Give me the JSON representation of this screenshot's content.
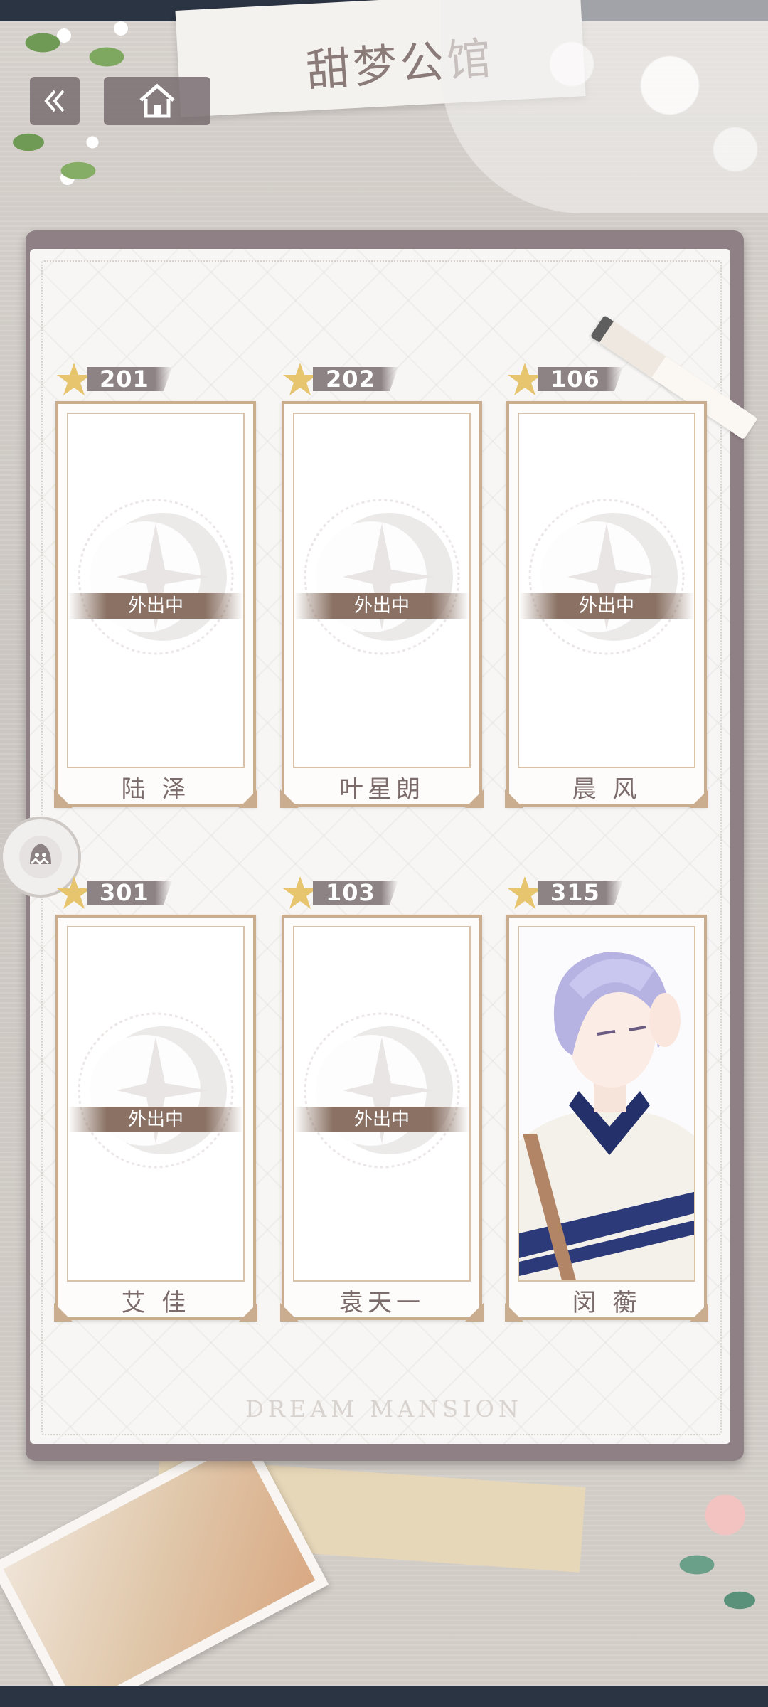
{
  "header": {
    "title_logo": "甜梦公馆"
  },
  "rooms": [
    {
      "number": "201",
      "status": "外出中",
      "name": "陆 泽",
      "present": false
    },
    {
      "number": "202",
      "status": "外出中",
      "name": "叶星朗",
      "present": false
    },
    {
      "number": "106",
      "status": "外出中",
      "name": "晨 风",
      "present": false
    },
    {
      "number": "301",
      "status": "外出中",
      "name": "艾 佳",
      "present": false
    },
    {
      "number": "103",
      "status": "外出中",
      "name": "袁天一",
      "present": false
    },
    {
      "number": "315",
      "status": "",
      "name": "闵 蘅",
      "present": true
    }
  ],
  "footer": {
    "brand": "DREAM MANSION"
  },
  "colors": {
    "frame": "#c9ad8e",
    "badge": "#8e8384",
    "status_band": "#8a7163",
    "name_text": "#7b6b6a",
    "star": "#e7c46e"
  },
  "icons": [
    "back-chevron-icon",
    "home-icon",
    "star-icon",
    "moon-emblem-icon",
    "ghost-icon"
  ]
}
